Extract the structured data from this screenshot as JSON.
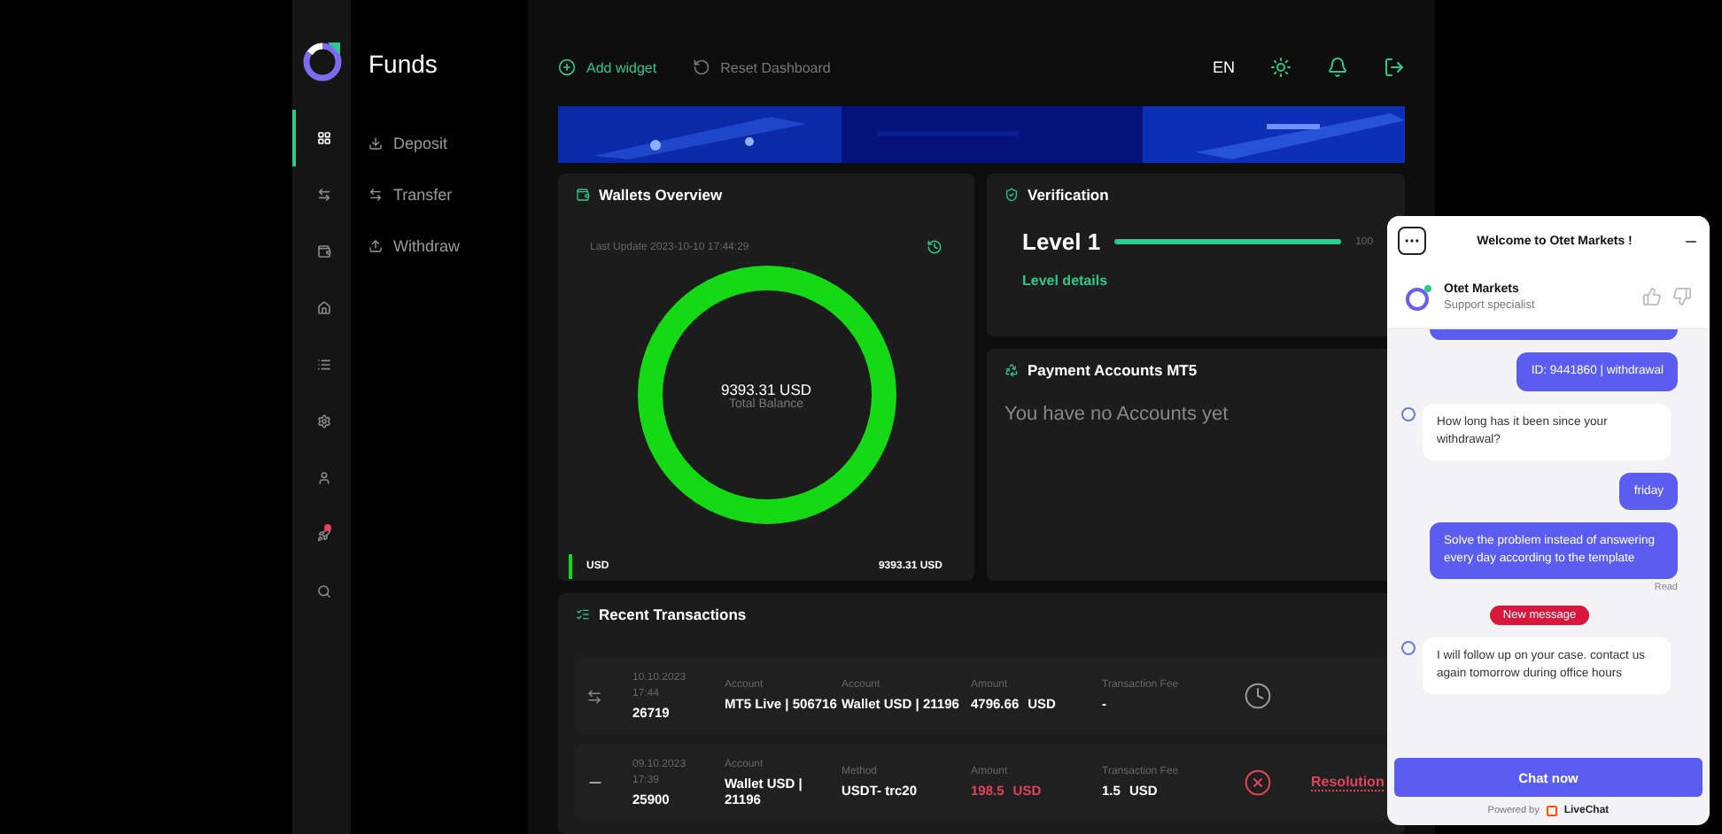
{
  "rail": [
    {
      "selected": true,
      "badge": false
    },
    {
      "selected": false,
      "badge": false
    },
    {
      "selected": false,
      "badge": false
    },
    {
      "selected": false,
      "badge": false
    },
    {
      "selected": false,
      "badge": false
    },
    {
      "selected": false,
      "badge": false
    },
    {
      "selected": false,
      "badge": false
    },
    {
      "selected": false,
      "badge": true
    },
    {
      "selected": false,
      "badge": false
    }
  ],
  "subnav": {
    "title": "Funds",
    "items": [
      {
        "label": "Deposit"
      },
      {
        "label": "Transfer"
      },
      {
        "label": "Withdraw"
      }
    ]
  },
  "toolbar": {
    "add": "Add widget",
    "reset": "Reset Dashboard",
    "language": "EN"
  },
  "wallets": {
    "title": "Wallets Overview",
    "last_update": "Last Update 2023-10-10 17:44:29",
    "total": "9393.31 USD",
    "total_label": "Total Balance",
    "legend": [
      {
        "name": "USD",
        "value": "9393.31 USD",
        "color": "#14d914"
      }
    ]
  },
  "verification": {
    "title": "Verification",
    "level_name": "Level 1",
    "level": 1,
    "percent": "100",
    "link": "Level details"
  },
  "payment_accounts": {
    "title": "Payment Accounts MT5",
    "empty": "You have no Accounts yet"
  },
  "transactions": {
    "title": "Recent Transactions",
    "rows": [
      {
        "kind": "transfer",
        "rejected": false,
        "date": "10.10.2023",
        "time": "17:44",
        "id": "26719",
        "fields": [
          {
            "label": "Account",
            "value": "MT5 Live | 506716"
          },
          {
            "label": "Account",
            "value": "Wallet USD | 21196"
          }
        ],
        "amount_label": "Amount",
        "amount": "4796.66",
        "currency": "USD",
        "fee_label": "Transaction Fee",
        "fee": "-"
      },
      {
        "kind": "withdrawal",
        "rejected": true,
        "date": "09.10.2023",
        "time": "17:39",
        "id": "25900",
        "fields": [
          {
            "label": "Account",
            "value": "Wallet USD | 21196"
          },
          {
            "label": "Method",
            "value": "USDT- trc20"
          }
        ],
        "amount_label": "Amount",
        "amount": "198.5",
        "currency": "USD",
        "fee_label": "Transaction Fee",
        "fee": "1.5",
        "fee_currency": "USD",
        "action": "Resolution"
      }
    ]
  },
  "chat": {
    "title": "Welcome to Otet Markets !",
    "agent": "Otet Markets",
    "role": "Support specialist",
    "messages": [
      {
        "kind": "user",
        "text": "ID: 9441860 | withdrawal"
      },
      {
        "kind": "agent",
        "text": "How long has it been since your withdrawal?"
      },
      {
        "kind": "user",
        "text": "friday"
      },
      {
        "kind": "user",
        "text": "Solve the problem instead of answering every day according to the template",
        "receipt": "Read"
      },
      {
        "kind": "divider",
        "text": "New message"
      },
      {
        "kind": "agent",
        "text": "I will follow up on your case. contact us again tomorrow during office hours"
      }
    ],
    "button": "Chat now",
    "powered": "Powered by",
    "brand": "LiveChat"
  }
}
